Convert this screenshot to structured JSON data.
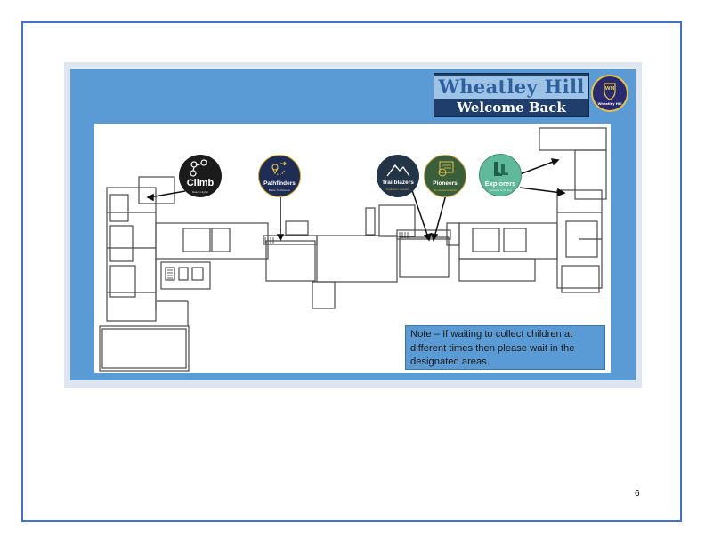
{
  "banner": {
    "title": "Wheatley Hill",
    "subtitle": "Welcome Back"
  },
  "logo": {
    "monogram": "WH",
    "caption": "Wheatley Hill"
  },
  "groups": [
    {
      "name": "Climb",
      "tagline": "Reach Higher",
      "color": "#1b1b1b"
    },
    {
      "name": "Pathfinders",
      "tagline": "Brave To Discover",
      "color": "#1f2d55"
    },
    {
      "name": "Trailblazers",
      "tagline": "Inspiration. Leaders",
      "color": "#243447"
    },
    {
      "name": "Pioneers",
      "tagline": "To venture forward",
      "color": "#3b5e3a"
    },
    {
      "name": "Explorers",
      "tagline": "Curiosity is the key",
      "color": "#5fb99a"
    }
  ],
  "note": "Note – If waiting to collect children at different times then please wait in the designated areas.",
  "page_number": "6",
  "colors": {
    "frame": "#4472c4",
    "panel": "#5b9bd5",
    "banner": "#1f3e6b"
  }
}
